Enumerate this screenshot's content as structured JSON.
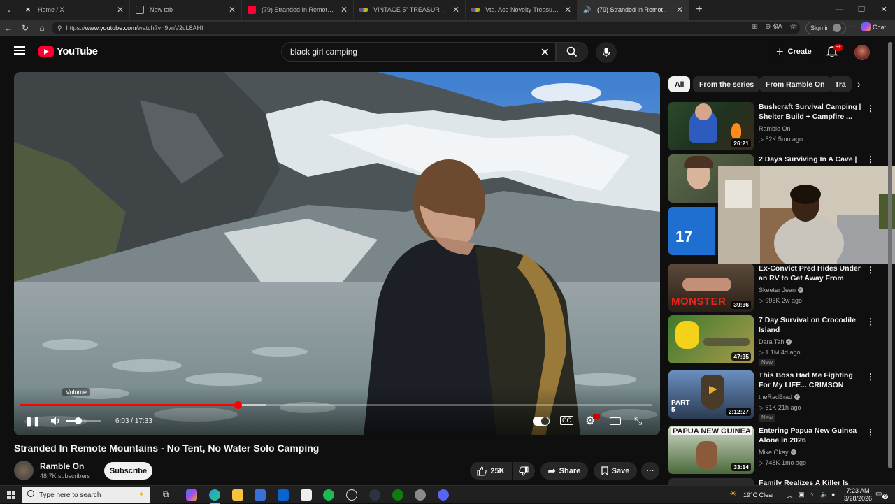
{
  "browser": {
    "tabs": [
      {
        "title": "Home / X",
        "icon": "x-icon",
        "active": false
      },
      {
        "title": "New tab",
        "icon": "newtab-icon",
        "active": false
      },
      {
        "title": "(79) Stranded In Remote Mountain",
        "icon": "youtube-icon",
        "active": false
      },
      {
        "title": "VINTAGE 5\" TREASURE TROLL DOLL",
        "icon": "ebay-icon",
        "active": false
      },
      {
        "title": "Vtg. Ace Novelty Treasure Troll Do",
        "icon": "ebay-icon",
        "active": false
      },
      {
        "title": "(79) Stranded In Remote Mou",
        "icon": "youtube-icon",
        "active": true
      }
    ],
    "url_prefix": "https://",
    "url_host": "www.youtube.com",
    "url_path": "/watch?v=9vnV2cL8AHI",
    "signin_label": "Sign in",
    "chat_label": "Chat"
  },
  "youtube": {
    "logo_text": "YouTube",
    "search_value": "black girl camping",
    "create_label": "Create",
    "notification_count": "9+"
  },
  "player": {
    "tooltip": "Volume",
    "current_time": "6:03",
    "duration": "17:33",
    "progress": 0.345,
    "buffered": 0.39
  },
  "video": {
    "title": "Stranded In Remote Mountains - No Tent, No Water Solo Camping",
    "channel": "Ramble On",
    "subscribers": "48.7K subscribers",
    "subscribe_label": "Subscribe",
    "likes": "25K",
    "share_label": "Share",
    "save_label": "Save"
  },
  "chips": [
    "All",
    "From the series",
    "From Ramble On",
    "Tra"
  ],
  "recommendations": [
    {
      "title": "Bushcraft Survival Camping | Shelter Build + Campfire ...",
      "channel": "Ramble On",
      "verified": false,
      "meta": "52K  5mo ago",
      "duration": "26:21",
      "isNew": false
    },
    {
      "title": "2 Days Surviving In A Cave |",
      "channel": "",
      "verified": false,
      "meta": "",
      "duration": "",
      "isNew": false
    },
    {
      "title": "",
      "channel": "",
      "verified": false,
      "meta": "",
      "duration": "",
      "isNew": false
    },
    {
      "title": "Ex-Convict Pred Hides Under an RV to Get Away From Police!",
      "channel": "Skeeter Jean",
      "verified": true,
      "meta": "993K  2w ago",
      "duration": "39:36",
      "isNew": false,
      "overlay": "MONSTER"
    },
    {
      "title": "7 Day Survival on Crocodile Island",
      "channel": "Dara Tah",
      "verified": true,
      "meta": "1.1M  4d ago",
      "duration": "47:35",
      "isNew": true
    },
    {
      "title": "This Boss Had Me Fighting For My LIFE... CRIMSON DESERT ...",
      "channel": "theRadBrad",
      "verified": true,
      "meta": "61K  21h ago",
      "duration": "2:12:27",
      "isNew": true,
      "overlay": "PART 5"
    },
    {
      "title": "Entering Papua New Guinea Alone in 2026",
      "channel": "Mike Okay",
      "verified": true,
      "meta": "748K  1mo ago",
      "duration": "33:14",
      "isNew": false,
      "overlay": "PAPUA NEW GUINEA"
    },
    {
      "title": "Family Realizes A Killer Is Living",
      "channel": "",
      "verified": false,
      "meta": "",
      "duration": "",
      "isNew": false
    }
  ],
  "new_badge": "New",
  "taskbar": {
    "search_placeholder": "Type here to search",
    "weather": "19°C  Clear",
    "time": "7:23 AM",
    "date": "3/28/2026",
    "notif_count": "9"
  },
  "colors": {
    "accent_red": "#ff0033",
    "progress_red": "#ff0000",
    "bg": "#0f0f0f"
  }
}
